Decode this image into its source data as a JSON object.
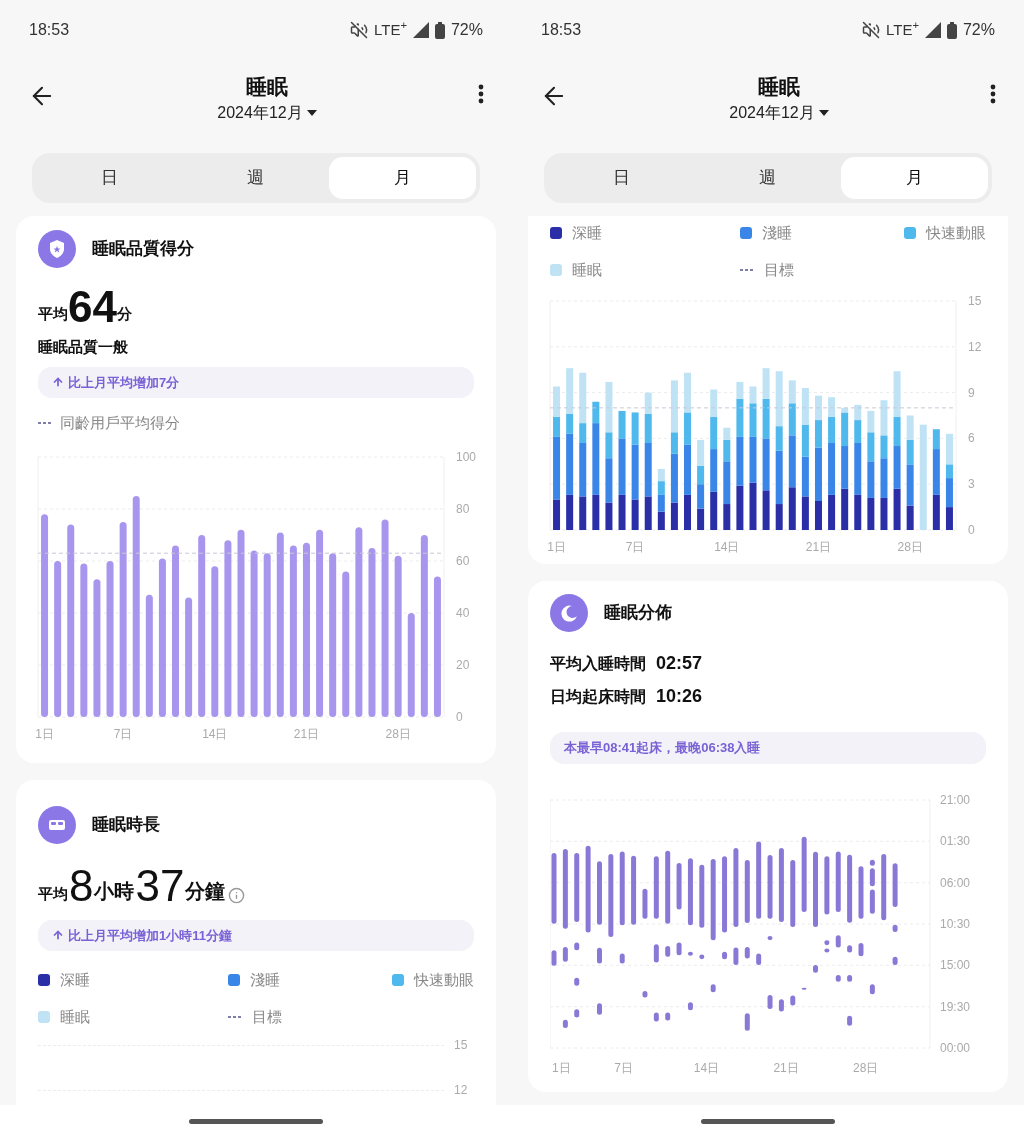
{
  "screens": [
    {
      "status_bar": {
        "time": "18:53",
        "network": "LTE$^{+}$",
        "battery": "72%"
      },
      "header": {
        "title": "睡眠",
        "date": "2024年12月"
      },
      "tabs": [
        {
          "label": "日",
          "selected": false
        },
        {
          "label": "週",
          "selected": false
        },
        {
          "label": "月",
          "selected": true
        }
      ],
      "cards": [
        {
          "kind": "score",
          "title": "睡眠品質得分",
          "average": {
            "prefix": "平均",
            "value": "64",
            "unit": "分"
          },
          "rating": "睡眠品質一般",
          "change": "比上月平均增加7分",
          "chart_data": {
            "type": "bar",
            "x": [
              1,
              2,
              3,
              4,
              5,
              6,
              7,
              8,
              9,
              10,
              11,
              12,
              13,
              14,
              15,
              16,
              17,
              18,
              19,
              20,
              21,
              22,
              23,
              24,
              25,
              26,
              27,
              28,
              29,
              30,
              31
            ],
            "values": [
              78,
              60,
              74,
              59,
              53,
              60,
              75,
              85,
              47,
              61,
              66,
              46,
              70,
              58,
              68,
              72,
              64,
              63,
              71,
              66,
              67,
              72,
              63,
              56,
              73,
              65,
              76,
              62,
              40,
              70,
              54
            ],
            "xlim": [
              0.5,
              31.5
            ],
            "ylim": [
              0,
              100
            ],
            "yticks": [
              0,
              20,
              40,
              60,
              80,
              100
            ],
            "grid": true,
            "xticks": [
              {
                "value": 1,
                "label": "1日"
              },
              {
                "value": 7,
                "label": "7日"
              },
              {
                "value": 14,
                "label": "14日"
              },
              {
                "value": 21,
                "label": "21日"
              },
              {
                "value": 28,
                "label": "28日"
              }
            ],
            "ref_lines": [
              {
                "axis": "y",
                "value": 63,
                "label": "同齡用戶平均得分"
              }
            ]
          }
        },
        {
          "kind": "duration",
          "title": "睡眠時長",
          "average": [
            {
              "kind": "label",
              "text": "平均"
            },
            {
              "kind": "number",
              "text": "8"
            },
            {
              "kind": "unit",
              "text": "小時"
            },
            {
              "kind": "number",
              "text": "37"
            },
            {
              "kind": "unit",
              "text": "分鐘"
            }
          ],
          "change": "比上月平均增加1小時11分鐘",
          "legend": [
            {
              "kind": "swatch",
              "label": "深睡",
              "color": "#2a2fa8"
            },
            {
              "kind": "swatch",
              "label": "淺睡",
              "color": "#3a86e8"
            },
            {
              "kind": "swatch",
              "label": "快速動眼",
              "color": "#4fb8ec"
            },
            {
              "kind": "swatch",
              "label": "睡眠",
              "color": "#bfe3f5"
            },
            {
              "kind": "dash",
              "label": "目標",
              "color": "#7d7fa8"
            }
          ],
          "axis_labels": [
            "15",
            "12"
          ]
        }
      ]
    },
    {
      "status_bar": {
        "time": "18:53",
        "network": "LTE$^{+}$",
        "battery": "72%"
      },
      "header": {
        "title": "睡眠",
        "date": "2024年12月"
      },
      "tabs": [
        {
          "label": "日",
          "selected": false
        },
        {
          "label": "週",
          "selected": false
        },
        {
          "label": "月",
          "selected": true
        }
      ],
      "cards": [
        {
          "kind": "duration_chart",
          "chart_data": {
            "type": "bar",
            "stacked": true,
            "grid": true,
            "xlim": [
              0.5,
              31.5
            ],
            "x": [
              1,
              2,
              3,
              4,
              5,
              6,
              7,
              8,
              9,
              10,
              11,
              12,
              13,
              14,
              15,
              16,
              17,
              18,
              19,
              20,
              21,
              22,
              23,
              24,
              25,
              26,
              27,
              28,
              29,
              30,
              31
            ],
            "series": [
              {
                "name": "深睡",
                "color": "#2a2fa8",
                "values": [
                  2.0,
                  2.3,
                  2.2,
                  2.3,
                  1.8,
                  2.3,
                  2.0,
                  2.2,
                  1.2,
                  1.8,
                  2.3,
                  1.4,
                  2.5,
                  1.7,
                  2.9,
                  3.1,
                  2.6,
                  1.7,
                  2.8,
                  2.2,
                  1.9,
                  2.3,
                  2.7,
                  2.3,
                  2.1,
                  2.1,
                  2.7,
                  1.6,
                  0,
                  2.3,
                  1.5
                ]
              },
              {
                "name": "淺睡",
                "color": "#3a86e8",
                "values": [
                  4.1,
                  4.0,
                  3.5,
                  4.7,
                  2.9,
                  3.7,
                  3.6,
                  3.5,
                  1.1,
                  3.2,
                  3.3,
                  1.6,
                  2.8,
                  2.8,
                  3.2,
                  3.0,
                  3.4,
                  3.5,
                  3.4,
                  2.6,
                  3.5,
                  3.4,
                  2.8,
                  3.4,
                  2.4,
                  2.6,
                  2.8,
                  2.7,
                  0,
                  3.0,
                  1.9
                ]
              },
              {
                "name": "快速動眼",
                "color": "#4fb8ec",
                "values": [
                  1.3,
                  1.3,
                  1.3,
                  1.4,
                  1.7,
                  1.8,
                  2.1,
                  1.9,
                  0.9,
                  1.4,
                  2.1,
                  1.2,
                  2.1,
                  1.4,
                  2.5,
                  2.2,
                  2.6,
                  1.6,
                  2.1,
                  2.1,
                  1.8,
                  1.7,
                  2.2,
                  1.5,
                  1.9,
                  1.5,
                  1.9,
                  1.6,
                  0,
                  1.3,
                  0.9
                ]
              },
              {
                "name": "睡眠",
                "color": "#bfe3f5",
                "values": [
                  2.0,
                  3.0,
                  3.3,
                  0,
                  3.3,
                  0,
                  0,
                  1.4,
                  0.8,
                  3.4,
                  2.6,
                  1.7,
                  1.8,
                  0.8,
                  1.1,
                  1.1,
                  2.0,
                  3.6,
                  1.5,
                  2.4,
                  1.6,
                  1.3,
                  0.3,
                  1.0,
                  1.4,
                  2.3,
                  3.0,
                  1.6,
                  6.9,
                  0,
                  2.0
                ]
              }
            ],
            "ylim": [
              0,
              15
            ],
            "yticks": [
              0,
              3,
              6,
              9,
              12,
              15
            ],
            "xticks": [
              {
                "value": 1,
                "label": "1日"
              },
              {
                "value": 7,
                "label": "7日"
              },
              {
                "value": 14,
                "label": "14日"
              },
              {
                "value": 21,
                "label": "21日"
              },
              {
                "value": 28,
                "label": "28日"
              }
            ],
            "ref_lines": [
              {
                "axis": "y",
                "value": 8,
                "label": "目標"
              }
            ]
          }
        },
        {
          "kind": "distribution",
          "title": "睡眠分佈",
          "stats": [
            {
              "label": "平均入睡時間",
              "value": "02:57"
            },
            {
              "label": "日均起床時間",
              "value": "10:26"
            }
          ],
          "note": "本最早08:41起床，最晚06:38入睡",
          "y_labels": [
            "21:00",
            "01:30",
            "06:00",
            "10:30",
            "15:00",
            "19:30",
            "00:00"
          ],
          "x_labels": [
            "1日",
            "7日",
            "14日",
            "21日",
            "28日"
          ]
        }
      ]
    }
  ]
}
